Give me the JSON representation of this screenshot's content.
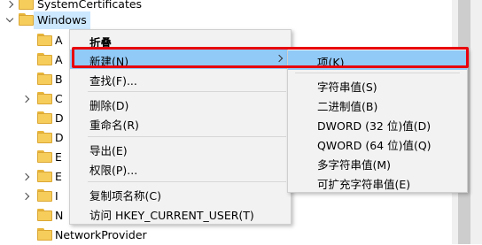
{
  "tree": {
    "rows": [
      {
        "label": "SystemCertificates"
      },
      {
        "label": "Windows"
      },
      {
        "label": "A"
      },
      {
        "label": "A"
      },
      {
        "label": "B"
      },
      {
        "label": "C"
      },
      {
        "label": "D"
      },
      {
        "label": "D"
      },
      {
        "label": "E"
      },
      {
        "label": "E"
      },
      {
        "label": "I"
      },
      {
        "label": "N"
      },
      {
        "label": "N"
      },
      {
        "label": "NetworkProvider"
      }
    ]
  },
  "context_menu": {
    "items": [
      {
        "label": "折叠"
      },
      {
        "label": "新建(N)"
      },
      {
        "label": "查找(F)..."
      },
      {
        "label": "删除(D)"
      },
      {
        "label": "重命名(R)"
      },
      {
        "label": "导出(E)"
      },
      {
        "label": "权限(P)..."
      },
      {
        "label": "复制项名称(C)"
      },
      {
        "label": "访问 HKEY_CURRENT_USER(T)"
      }
    ]
  },
  "submenu": {
    "items": [
      {
        "label": "项(K)"
      },
      {
        "label": "字符串值(S)"
      },
      {
        "label": "二进制值(B)"
      },
      {
        "label": "DWORD (32 位)值(D)"
      },
      {
        "label": "QWORD (64 位)值(Q)"
      },
      {
        "label": "多字符串值(M)"
      },
      {
        "label": "可扩充字符串值(E)"
      }
    ]
  },
  "colors": {
    "highlight": "#91c9f7",
    "selection": "#cce8ff",
    "annotation": "#e8000d",
    "folder": "#f6cd5b"
  }
}
